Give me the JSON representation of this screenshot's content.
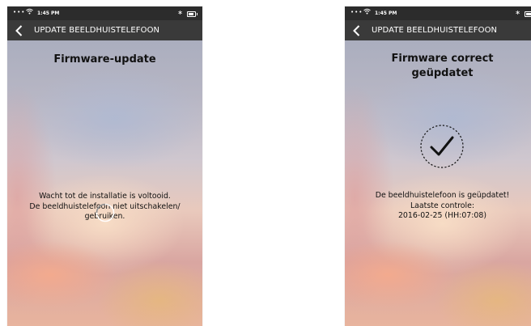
{
  "status_bar": {
    "signal": "•••",
    "time": "1:45 PM",
    "bluetooth": "∗"
  },
  "screens": [
    {
      "nav_title": "UPDATE BEELDHUISTELEFOON",
      "heading": "Firmware-update",
      "message_lines": [
        "Wacht tot de installatie is voltooid.",
        "De beeldhuistelefoon niet uitschakelen/",
        "gebruiken."
      ]
    },
    {
      "nav_title": "UPDATE BEELDHUISTELEFOON",
      "heading_lines": [
        "Firmware correct",
        "geüpdatet"
      ],
      "message_lines": [
        "De beeldhuistelefoon is geüpdatet!",
        "Laatste controle:",
        "2016-02-25 (HH:07:08)"
      ]
    }
  ],
  "icons": {
    "back": "chevron-left-icon",
    "spinner": "loading-spinner-icon",
    "success": "checkmark-circle-icon",
    "wifi": "wifi-icon",
    "bluetooth": "bluetooth-icon",
    "battery": "battery-icon"
  },
  "colors": {
    "status_bar": "#2c2c2c",
    "nav_bar": "#3a3a3a",
    "text": "#111111"
  }
}
